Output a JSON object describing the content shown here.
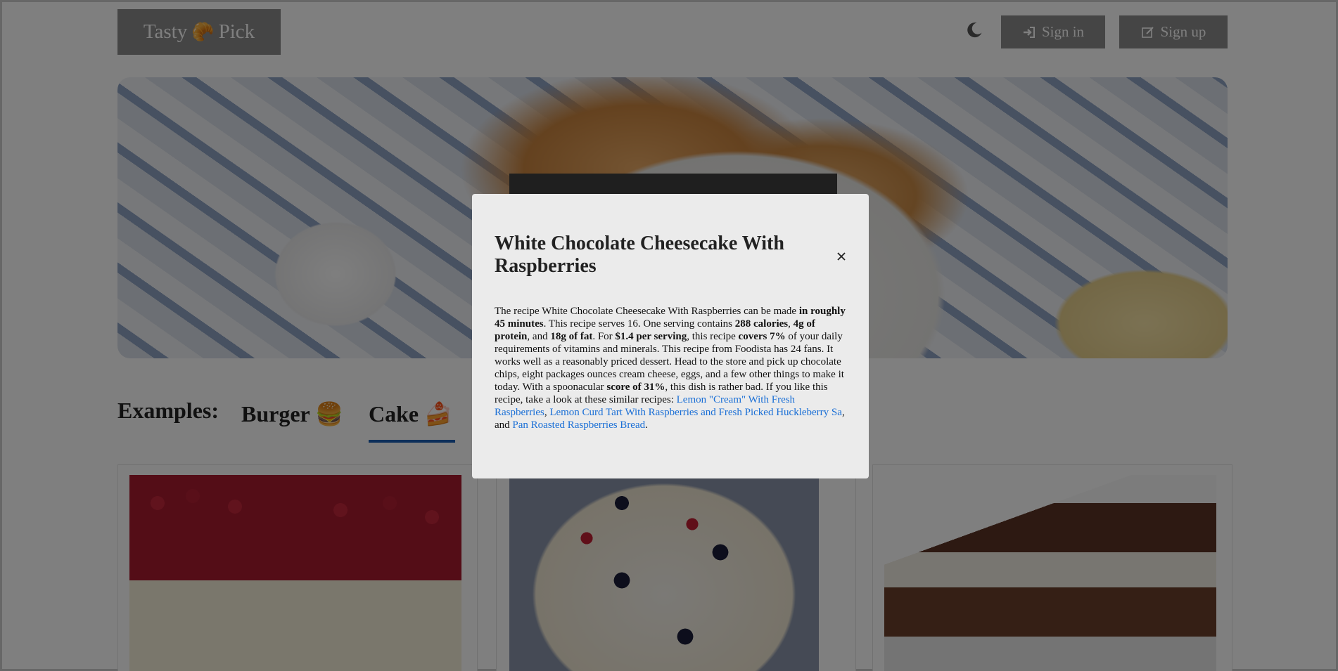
{
  "header": {
    "logo_left": "Tasty",
    "logo_icon": "🥐",
    "logo_right": "Pick",
    "theme_icon": "moon-icon",
    "signin_label": "Sign in",
    "signup_label": "Sign up"
  },
  "examples": {
    "label": "Examples:",
    "tabs": [
      {
        "label": "Burger 🍔",
        "active": false
      },
      {
        "label": "Cake 🍰",
        "active": true
      }
    ]
  },
  "modal": {
    "title": "White Chocolate Cheesecake With Raspberries",
    "close_icon": "close-icon",
    "body": {
      "t1": "The recipe White Chocolate Cheesecake With Raspberries can be made ",
      "b1": "in roughly 45 minutes",
      "t2": ". This recipe serves 16. One serving contains ",
      "b2": "288 calories",
      "t3": ", ",
      "b3": "4g of protein",
      "t4": ", and ",
      "b4": "18g of fat",
      "t5": ". For ",
      "b5": "$1.4 per serving",
      "t6": ", this recipe ",
      "b6": "covers 7%",
      "t7": " of your daily requirements of vitamins and minerals. This recipe from Foodista has 24 fans. It works well as a reasonably priced dessert. Head to the store and pick up chocolate chips, eight packages ounces cream cheese, eggs, and a few other things to make it today. With a spoonacular ",
      "b7": "score of 31%",
      "t8": ", this dish is rather bad. If you like this recipe, take a look at these similar recipes: ",
      "l1": "Lemon \"Cream\" With Fresh Raspberries",
      "t9": ", ",
      "l2": "Lemon Curd Tart With Raspberries and Fresh Picked Huckleberry Sa",
      "t10": ", and ",
      "l3": "Pan Roasted Raspberries Bread",
      "t11": "."
    }
  },
  "colors": {
    "overlay": "rgba(0,0,0,0.5)",
    "modal_bg": "#ebebeb",
    "link": "#1a6fd6",
    "tab_underline": "#1a5fb4",
    "header_button": "#8a8a8a"
  }
}
